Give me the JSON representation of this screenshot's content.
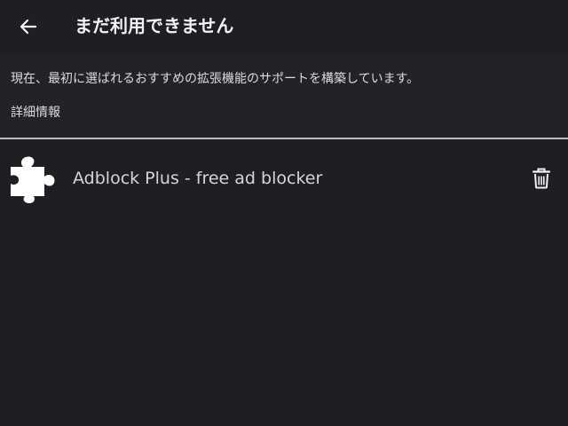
{
  "header": {
    "back_icon": "arrow-left-icon",
    "title": "まだ利用できません"
  },
  "notice": {
    "message": "現在、最初に選ばれるおすすめの拡張機能のサポートを構築しています。",
    "learn_more": "詳細情報"
  },
  "extensions": [
    {
      "icon": "puzzle-piece-icon",
      "name": "Adblock Plus - free ad blocker",
      "action_icon": "trash-icon"
    }
  ],
  "colors": {
    "background": "#1f1e23",
    "notice_background": "#232228",
    "text_primary": "#f2f2f4",
    "divider": "#bdbdc2"
  }
}
